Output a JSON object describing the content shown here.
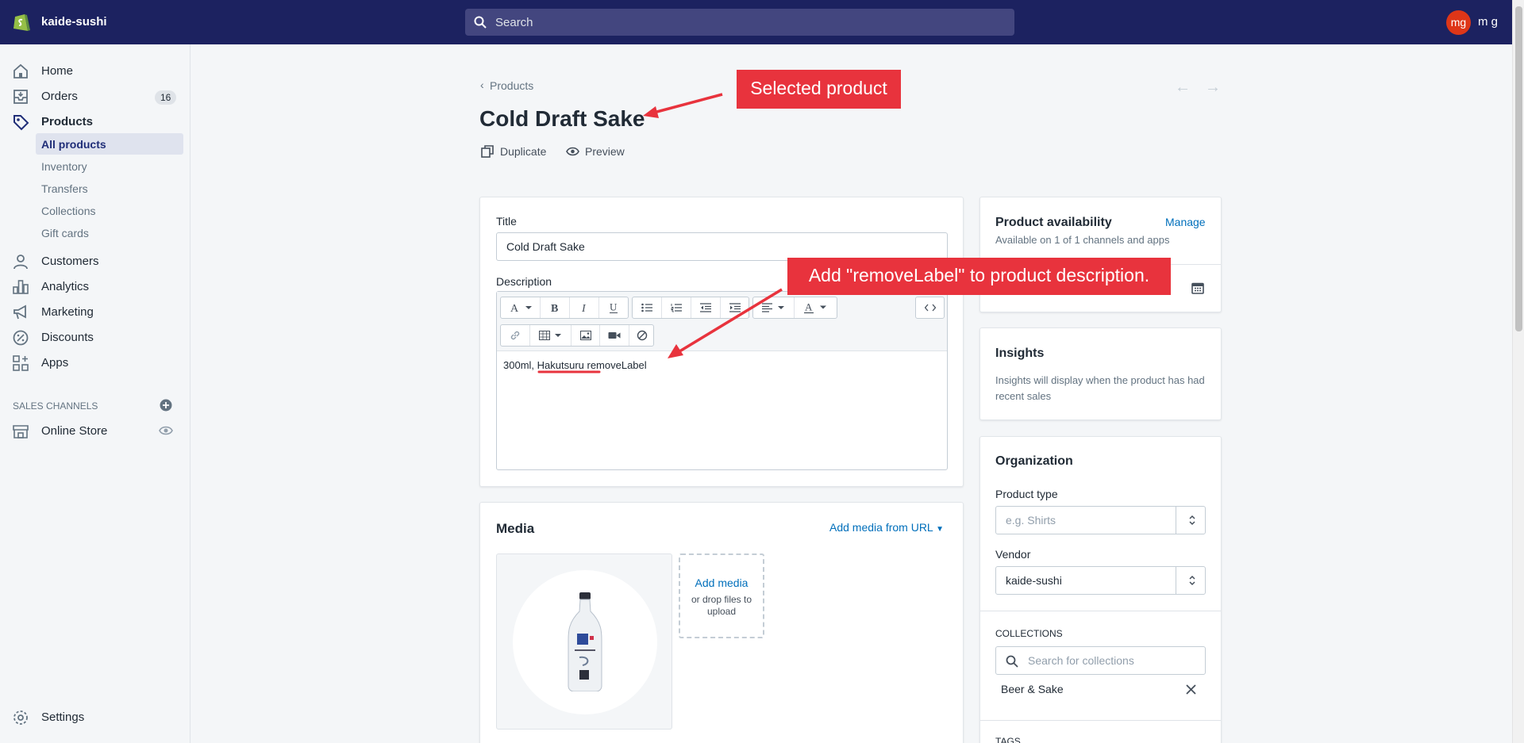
{
  "topbar": {
    "store_name": "kaide-sushi",
    "search_placeholder": "Search",
    "avatar_initials": "mg",
    "user_name": "m g"
  },
  "sidebar": {
    "items": [
      {
        "label": "Home",
        "icon": "home-icon"
      },
      {
        "label": "Orders",
        "icon": "orders-icon",
        "badge": "16"
      },
      {
        "label": "Products",
        "icon": "tag-icon"
      },
      {
        "label": "Customers",
        "icon": "person-icon"
      },
      {
        "label": "Analytics",
        "icon": "bar-chart-icon"
      },
      {
        "label": "Marketing",
        "icon": "megaphone-icon"
      },
      {
        "label": "Discounts",
        "icon": "discount-icon"
      },
      {
        "label": "Apps",
        "icon": "apps-icon"
      }
    ],
    "product_sub_items": [
      "All products",
      "Inventory",
      "Transfers",
      "Collections",
      "Gift cards"
    ],
    "sales_channels_heading": "SALES CHANNELS",
    "online_store": "Online Store",
    "settings": "Settings"
  },
  "header": {
    "back_label": "Products",
    "title": "Cold Draft Sake",
    "duplicate_label": "Duplicate",
    "preview_label": "Preview"
  },
  "product": {
    "title_label": "Title",
    "title_value": "Cold Draft Sake",
    "description_label": "Description",
    "description_text": "300ml, Hakutsuru removeLabel"
  },
  "media": {
    "title": "Media",
    "add_from_url": "Add media from URL",
    "add_media": "Add media",
    "drop_hint": "or drop files to upload"
  },
  "availability": {
    "title": "Product availability",
    "manage": "Manage",
    "subtitle": "Available on 1 of 1 channels and apps"
  },
  "insights": {
    "title": "Insights",
    "text": "Insights will display when the product has had recent sales"
  },
  "organization": {
    "title": "Organization",
    "product_type_label": "Product type",
    "product_type_placeholder": "e.g. Shirts",
    "vendor_label": "Vendor",
    "vendor_value": "kaide-sushi",
    "collections_heading": "COLLECTIONS",
    "collections_placeholder": "Search for collections",
    "collection_tag": "Beer & Sake",
    "tags_heading": "TAGS"
  },
  "annotations": {
    "selected_product": "Selected product",
    "add_label": "Add \"removeLabel\" to product description."
  },
  "colors": {
    "topbar": "#1c2260",
    "accent_link": "#006fbb",
    "callout": "#e8333d",
    "avatar": "#de3618"
  }
}
